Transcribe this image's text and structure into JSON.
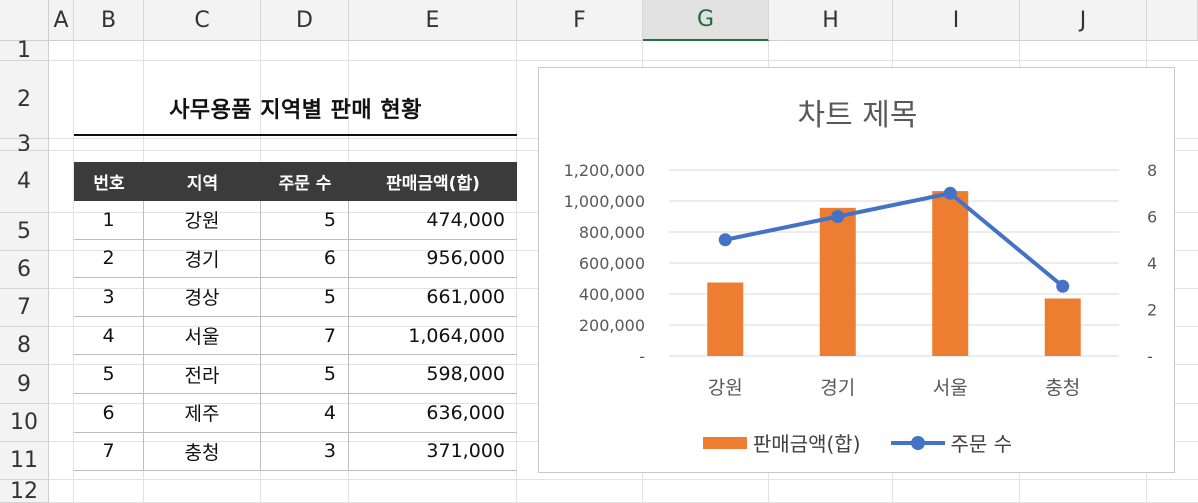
{
  "columns": [
    "A",
    "B",
    "C",
    "D",
    "E",
    "F",
    "G",
    "H",
    "I",
    "J"
  ],
  "selected_column": "G",
  "rows": [
    "1",
    "2",
    "3",
    "4",
    "5",
    "6",
    "7",
    "8",
    "9",
    "10",
    "11",
    "12"
  ],
  "sheet_title": "사무용품 지역별 판매 현황",
  "table": {
    "headers": [
      "번호",
      "지역",
      "주문 수",
      "판매금액(합)"
    ],
    "rows": [
      [
        "1",
        "강원",
        "5",
        "474,000"
      ],
      [
        "2",
        "경기",
        "6",
        "956,000"
      ],
      [
        "3",
        "경상",
        "5",
        "661,000"
      ],
      [
        "4",
        "서울",
        "7",
        "1,064,000"
      ],
      [
        "5",
        "전라",
        "5",
        "598,000"
      ],
      [
        "6",
        "제주",
        "4",
        "636,000"
      ],
      [
        "7",
        "충청",
        "3",
        "371,000"
      ]
    ]
  },
  "chart_data": {
    "type": "bar",
    "title": "차트 제목",
    "categories": [
      "강원",
      "경기",
      "서울",
      "충청"
    ],
    "series": [
      {
        "name": "판매금액(합)",
        "type": "bar",
        "axis": "left",
        "color": "#ed7d31",
        "values": [
          474000,
          956000,
          1064000,
          371000
        ]
      },
      {
        "name": "주문 수",
        "type": "line",
        "axis": "right",
        "color": "#4472c4",
        "values": [
          5,
          6,
          7,
          3
        ]
      }
    ],
    "y_left": {
      "range": [
        0,
        1200000
      ],
      "ticks": [
        "-",
        "200,000",
        "400,000",
        "600,000",
        "800,000",
        "1,000,000",
        "1,200,000"
      ]
    },
    "y_right": {
      "range": [
        0,
        8
      ],
      "ticks": [
        "-",
        "2",
        "4",
        "6",
        "8"
      ]
    },
    "grid": true,
    "legend": "bottom"
  }
}
